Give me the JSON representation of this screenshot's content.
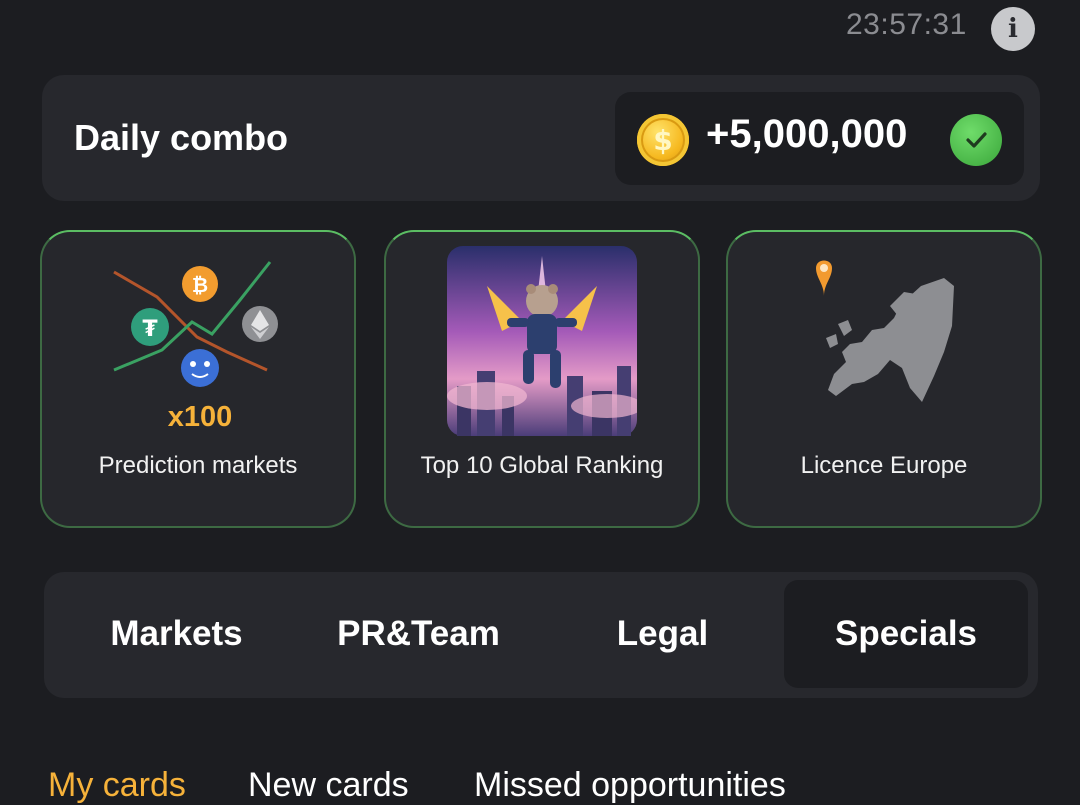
{
  "header": {
    "timer": "23:57:31",
    "info_icon": "info-icon"
  },
  "daily_combo": {
    "title": "Daily combo",
    "reward": "+5,000,000",
    "coin_symbol": "$",
    "completed_icon": "check-icon"
  },
  "cards": [
    {
      "label": "Prediction markets",
      "badge": "x100",
      "icon": "prediction-markets-art"
    },
    {
      "label": "Top 10 Global Ranking",
      "icon": "flying-hamster-art"
    },
    {
      "label": "Licence Europe",
      "icon": "europe-map-art"
    }
  ],
  "category_tabs": [
    {
      "label": "Markets",
      "active": false
    },
    {
      "label": "PR&Team",
      "active": false
    },
    {
      "label": "Legal",
      "active": false
    },
    {
      "label": "Specials",
      "active": true
    }
  ],
  "card_tabs": [
    {
      "label": "My cards",
      "active": true
    },
    {
      "label": "New cards",
      "active": false
    },
    {
      "label": "Missed opportunities",
      "active": false
    }
  ],
  "colors": {
    "background": "#1c1d21",
    "panel": "#27282d",
    "card_border": "#5bbd63",
    "accent_orange": "#f6b23a"
  }
}
